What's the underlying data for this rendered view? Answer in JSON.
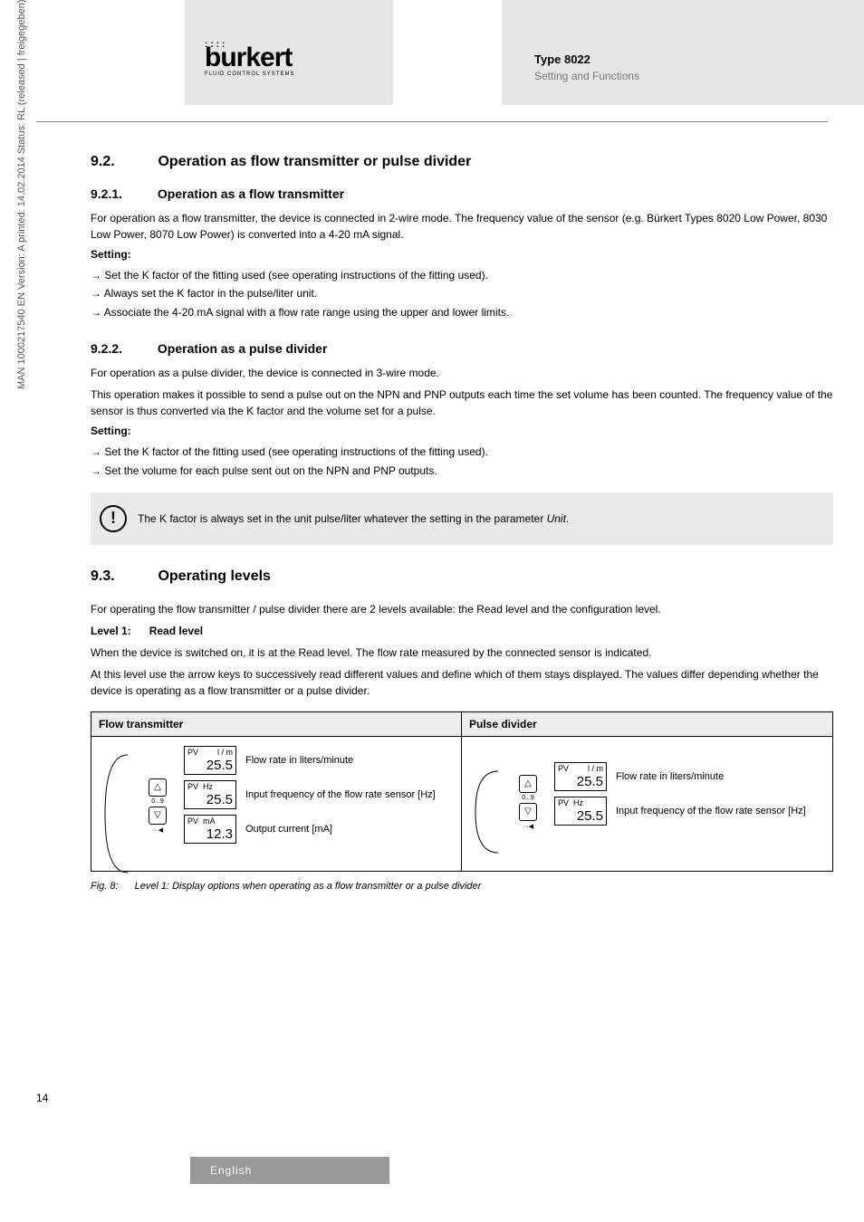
{
  "header": {
    "brand": "burkert",
    "brand_tag": "FLUID CONTROL SYSTEMS",
    "type_label": "Type 8022",
    "subtitle": "Setting and Functions"
  },
  "section92": {
    "num": "9.2.",
    "title": "Operation as flow transmitter or pulse divider"
  },
  "section921": {
    "num": "9.2.1.",
    "title": "Operation as a flow transmitter",
    "p1": "For operation as a flow transmitter, the device is connected in 2-wire mode. The frequency value of the sensor (e.g. Bürkert Types 8020 Low Power, 8030 Low Power, 8070 Low Power) is converted into a 4-20 mA signal.",
    "setting": "Setting:",
    "b1": "Set the K factor of the fitting used (see operating instructions of the fitting used).",
    "b2": "Always set the K factor in the pulse/liter unit.",
    "b3": "Associate the 4-20 mA signal with a flow rate range using the upper and lower limits."
  },
  "section922": {
    "num": "9.2.2.",
    "title": "Operation as a pulse divider",
    "p1": "For operation as a pulse divider, the device is connected in 3-wire mode.",
    "p2": "This operation makes it possible to send a pulse out on the NPN and PNP outputs each time the set volume has been counted. The frequency value of the sensor is thus converted via the K factor and the volume set for a pulse.",
    "setting": "Setting:",
    "b1": "Set the K factor of the fitting used (see operating instructions of the fitting used).",
    "b2": "Set the volume for each pulse sent out on the NPN and PNP outputs."
  },
  "note": {
    "text": "The K factor is always set in the unit pulse/liter whatever the setting in the parameter ",
    "em": "Unit",
    "suffix": "."
  },
  "section93": {
    "num": "9.3.",
    "title": "Operating levels",
    "p1": "For operating the flow transmitter / pulse divider there are 2 levels available: the Read level and the configuration level.",
    "level_label": "Level 1:",
    "level_name": "Read level",
    "p2": "When the device is switched on, it is at the Read level. The flow rate measured by the connected sensor is indicated.",
    "p3": "At this level use the arrow keys to successively read different values and define which of them stays displayed. The values differ depending whether the device is operating as a flow transmitter or a pulse divider."
  },
  "table": {
    "col1_header": "Flow transmitter",
    "col2_header": "Pulse divider",
    "ft": {
      "d1": {
        "lbl": "PV",
        "unit": "l / m",
        "val": "25.5",
        "desc": "Flow rate in liters/minute"
      },
      "d2": {
        "lbl": "PV",
        "unit": "Hz",
        "val": "25.5",
        "desc": "Input frequency of the flow rate sensor [Hz]"
      },
      "d3": {
        "lbl": "PV",
        "unit": "mA",
        "val": "12.3",
        "desc": "Output current [mA]"
      }
    },
    "pd": {
      "d1": {
        "lbl": "PV",
        "unit": "l / m",
        "val": "25.5",
        "desc": "Flow rate in liters/minute"
      },
      "d2": {
        "lbl": "PV",
        "unit": "Hz",
        "val": "25.5",
        "desc": "Input frequency of the flow rate sensor [Hz]"
      }
    },
    "keys": {
      "up": "△",
      "up_sub": "0...9",
      "down": "▽",
      "down_sub": "···◀"
    }
  },
  "figure": {
    "num": "Fig. 8:",
    "caption": "Level 1: Display options when operating as a flow transmitter or a pulse divider"
  },
  "pagenum": "14",
  "sidetext": "MAN 1000217540 EN Version: A  printed: 14.02.2014 Status: RL (released | freigegeben)",
  "footer_lang": "English"
}
